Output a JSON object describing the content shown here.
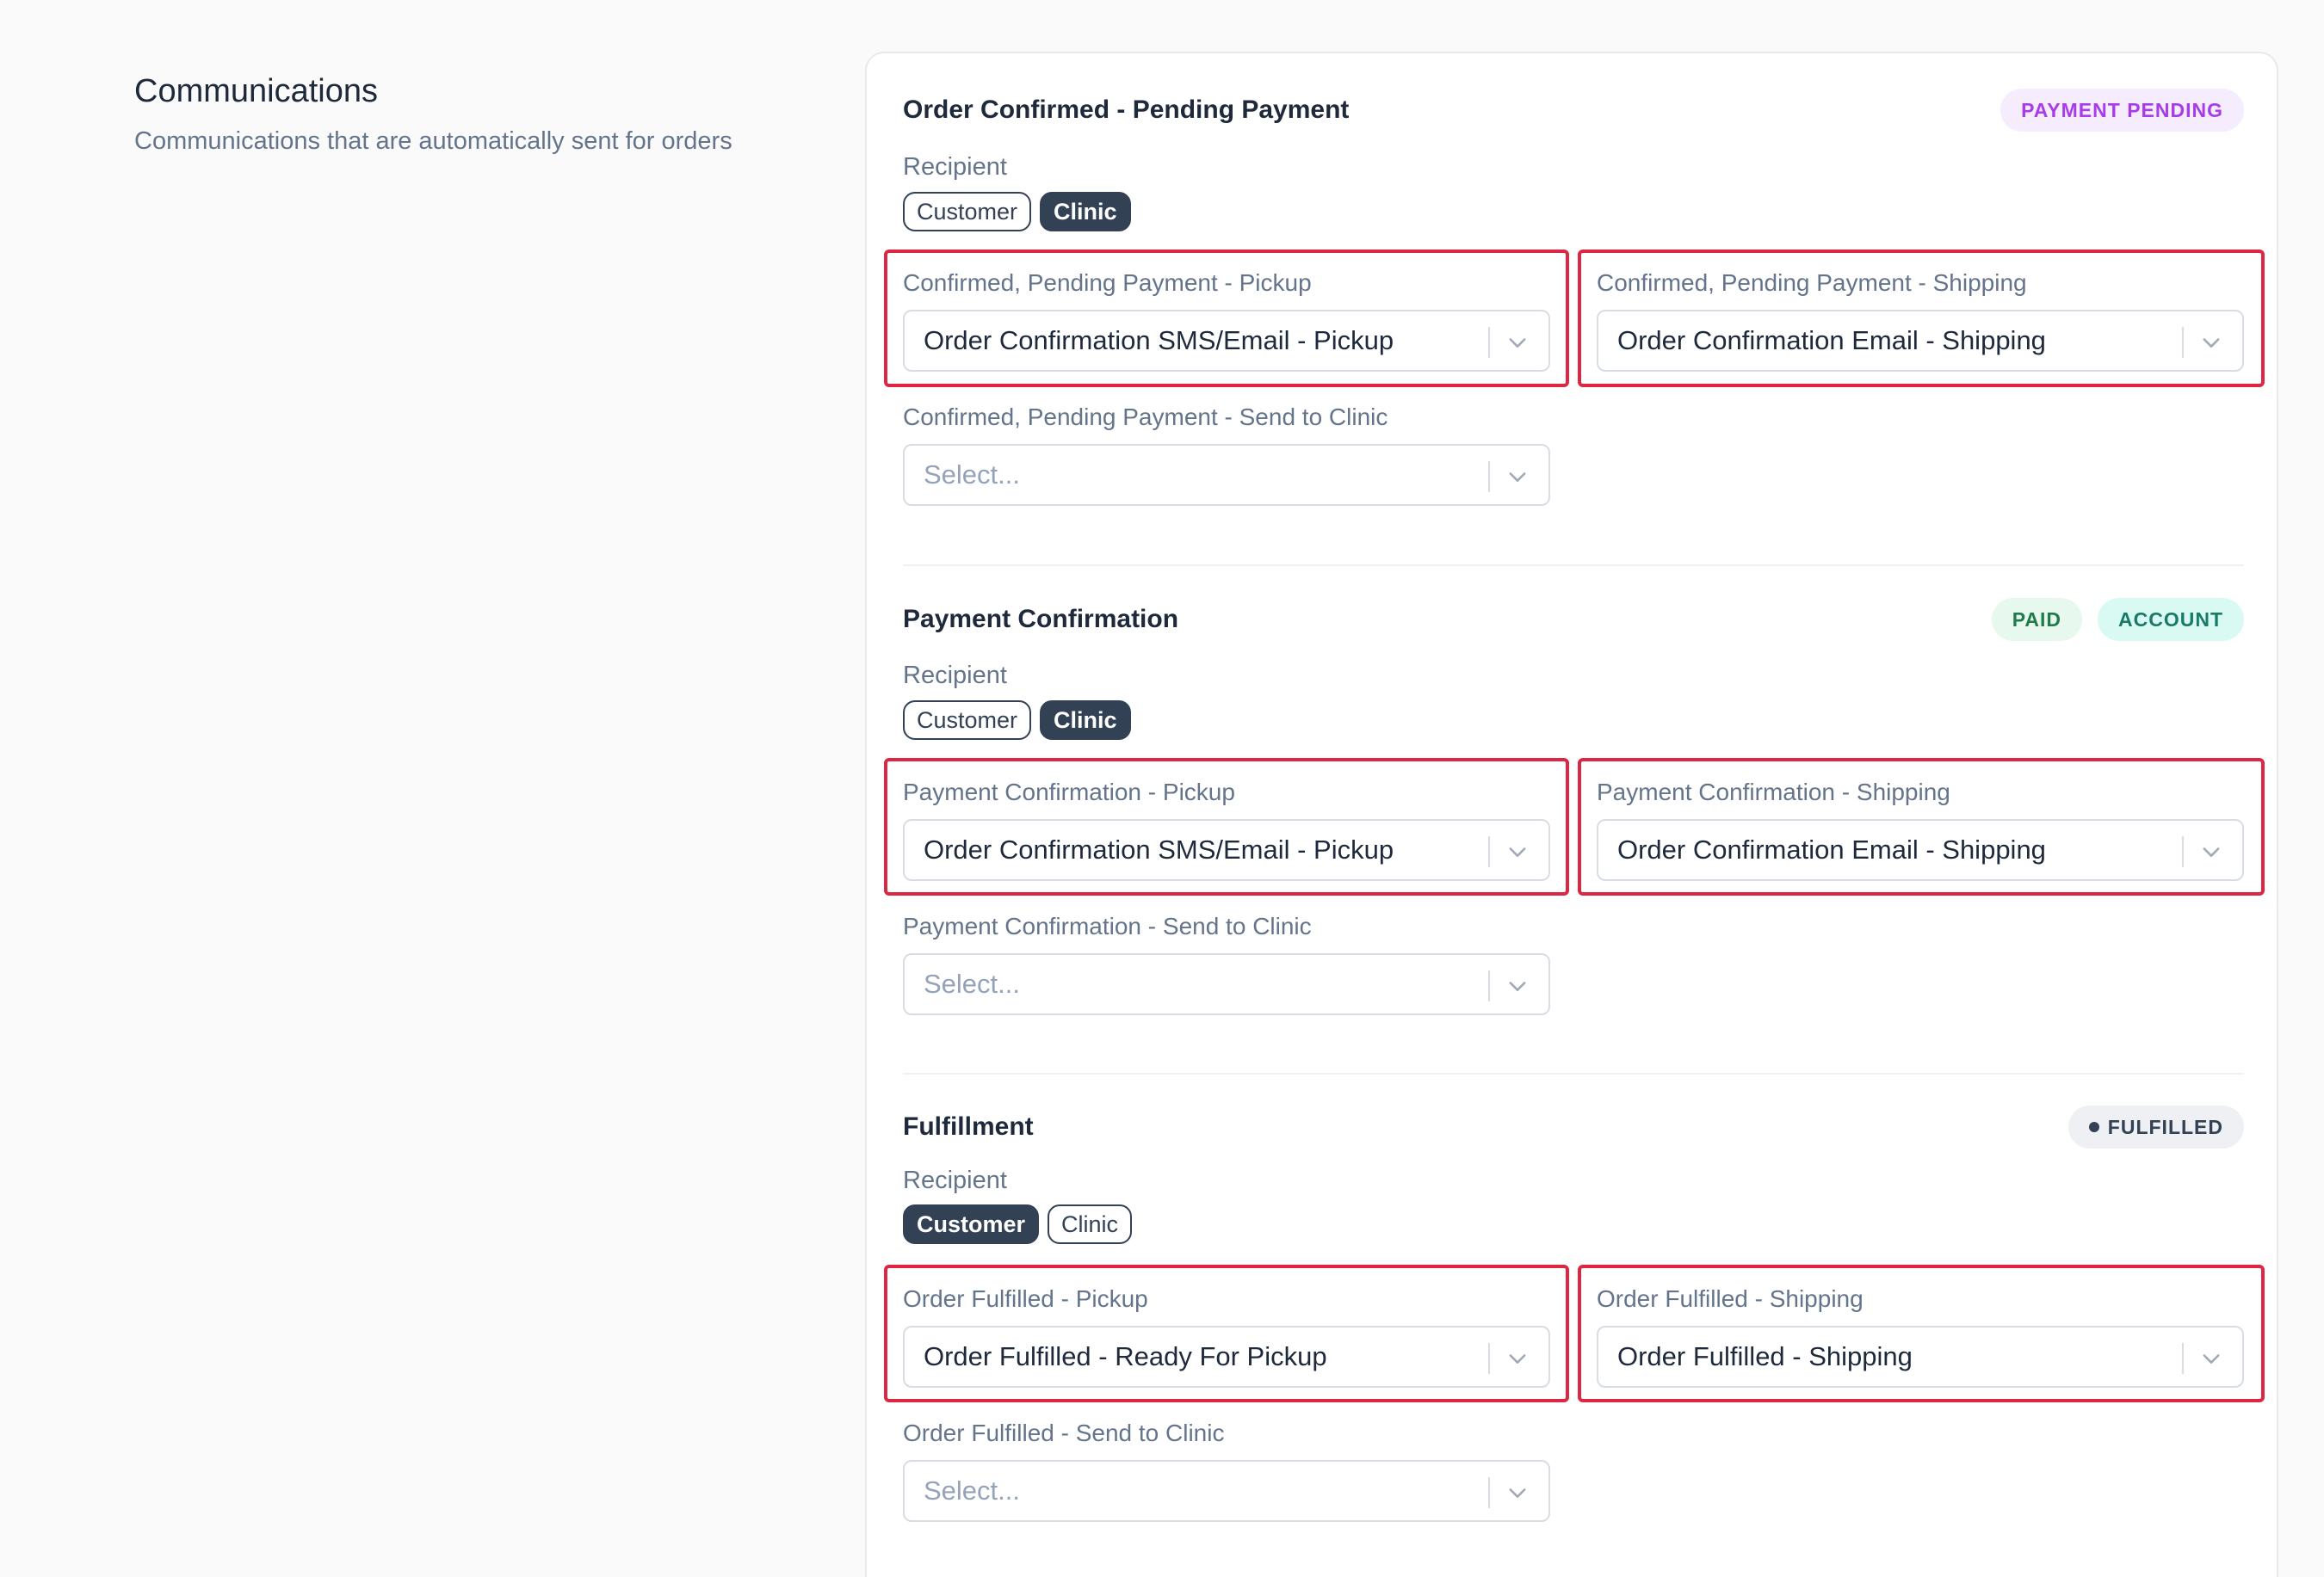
{
  "intro": {
    "title": "Communications",
    "subtitle": "Communications that are automatically sent for orders"
  },
  "recipient_label": "Recipient",
  "sections": [
    {
      "title": "Order Confirmed - Pending Payment",
      "badges": [
        {
          "label": "PAYMENT PENDING",
          "bg": "#f5ecfe",
          "fg": "#a83ce8"
        }
      ],
      "chips": [
        {
          "label": "Customer",
          "selected": false
        },
        {
          "label": "Clinic",
          "selected": true
        }
      ],
      "fields": {
        "pickup": {
          "label": "Confirmed, Pending Payment - Pickup",
          "value": "Order Confirmation SMS/Email - Pickup"
        },
        "shipping": {
          "label": "Confirmed, Pending Payment - Shipping",
          "value": "Order Confirmation Email - Shipping"
        },
        "clinic": {
          "label": "Confirmed, Pending Payment - Send to Clinic",
          "placeholder": "Select..."
        }
      }
    },
    {
      "title": "Payment Confirmation",
      "badges": [
        {
          "label": "PAID",
          "bg": "#e7f8ee",
          "fg": "#217a4a"
        },
        {
          "label": "ACCOUNT",
          "bg": "#d9faf3",
          "fg": "#1a7a68"
        }
      ],
      "chips": [
        {
          "label": "Customer",
          "selected": false
        },
        {
          "label": "Clinic",
          "selected": true
        }
      ],
      "fields": {
        "pickup": {
          "label": "Payment Confirmation - Pickup",
          "value": "Order Confirmation SMS/Email - Pickup"
        },
        "shipping": {
          "label": "Payment Confirmation - Shipping",
          "value": "Order Confirmation Email - Shipping"
        },
        "clinic": {
          "label": "Payment Confirmation - Send to Clinic",
          "placeholder": "Select..."
        }
      }
    },
    {
      "title": "Fulfillment",
      "badges": [
        {
          "label": "FULFILLED",
          "bg": "#eef0f3",
          "fg": "#334155"
        }
      ],
      "chips": [
        {
          "label": "Customer",
          "selected": true
        },
        {
          "label": "Clinic",
          "selected": false
        }
      ],
      "fields": {
        "pickup": {
          "label": "Order Fulfilled - Pickup",
          "value": "Order Fulfilled - Ready For Pickup"
        },
        "shipping": {
          "label": "Order Fulfilled - Shipping",
          "value": "Order Fulfilled - Shipping"
        },
        "clinic": {
          "label": "Order Fulfilled - Send to Clinic",
          "placeholder": "Select..."
        }
      }
    }
  ],
  "colors": {
    "highlight": "#dc2742",
    "chip_selected": "#334155"
  },
  "icons": {
    "dropdown": "chevron-down-icon",
    "status_dot": "dot-icon"
  }
}
